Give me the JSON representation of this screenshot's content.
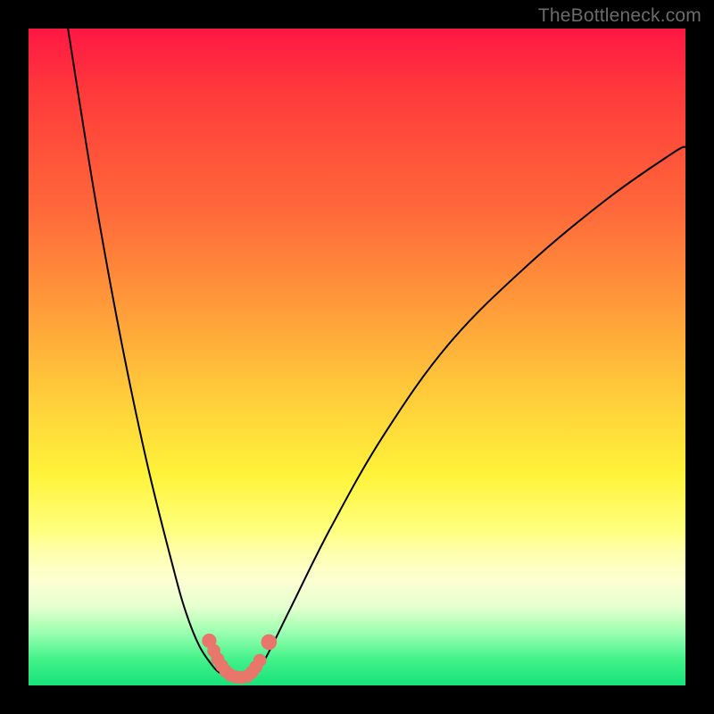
{
  "watermark": {
    "text": "TheBottleneck.com"
  },
  "chart_data": {
    "type": "line",
    "title": "",
    "xlabel": "",
    "ylabel": "",
    "xlim": [
      0,
      100
    ],
    "ylim": [
      0,
      100
    ],
    "grid": false,
    "legend": false,
    "series": [
      {
        "name": "left-arm",
        "color": "#000000",
        "x": [
          6,
          10,
          14,
          18,
          22,
          24,
          26,
          28,
          29,
          30
        ],
        "y": [
          100,
          75,
          53,
          34,
          18,
          11,
          6,
          3,
          2,
          1.5
        ]
      },
      {
        "name": "valley-floor",
        "color": "#000000",
        "x": [
          30,
          31,
          32,
          33,
          34
        ],
        "y": [
          1.5,
          1,
          1,
          1,
          1.2
        ]
      },
      {
        "name": "right-arm",
        "color": "#000000",
        "x": [
          34,
          36,
          40,
          46,
          54,
          64,
          76,
          88,
          98,
          100
        ],
        "y": [
          1.2,
          4,
          12,
          24,
          38,
          52,
          64,
          74,
          81,
          82
        ]
      }
    ],
    "markers": [
      {
        "name": "dot",
        "x": 27.5,
        "y": 6.8,
        "r": 1.1,
        "color": "#e8766a"
      },
      {
        "name": "dot",
        "x": 28.2,
        "y": 5.3,
        "r": 1.0,
        "color": "#e8766a"
      },
      {
        "name": "dot",
        "x": 28.8,
        "y": 4.0,
        "r": 1.0,
        "color": "#e8766a"
      },
      {
        "name": "dot",
        "x": 29.4,
        "y": 3.0,
        "r": 1.0,
        "color": "#e8766a"
      },
      {
        "name": "dot",
        "x": 30.0,
        "y": 2.2,
        "r": 1.0,
        "color": "#e8766a"
      },
      {
        "name": "dot",
        "x": 30.7,
        "y": 1.6,
        "r": 1.0,
        "color": "#e8766a"
      },
      {
        "name": "dot",
        "x": 31.5,
        "y": 1.3,
        "r": 1.0,
        "color": "#e8766a"
      },
      {
        "name": "dot",
        "x": 32.4,
        "y": 1.2,
        "r": 1.0,
        "color": "#e8766a"
      },
      {
        "name": "dot",
        "x": 33.3,
        "y": 1.4,
        "r": 1.0,
        "color": "#e8766a"
      },
      {
        "name": "dot",
        "x": 34.0,
        "y": 2.0,
        "r": 1.0,
        "color": "#e8766a"
      },
      {
        "name": "dot",
        "x": 34.6,
        "y": 2.8,
        "r": 1.0,
        "color": "#e8766a"
      },
      {
        "name": "dot",
        "x": 35.2,
        "y": 3.8,
        "r": 1.0,
        "color": "#e8766a"
      },
      {
        "name": "dot",
        "x": 36.6,
        "y": 6.6,
        "r": 1.2,
        "color": "#e8766a"
      }
    ]
  }
}
